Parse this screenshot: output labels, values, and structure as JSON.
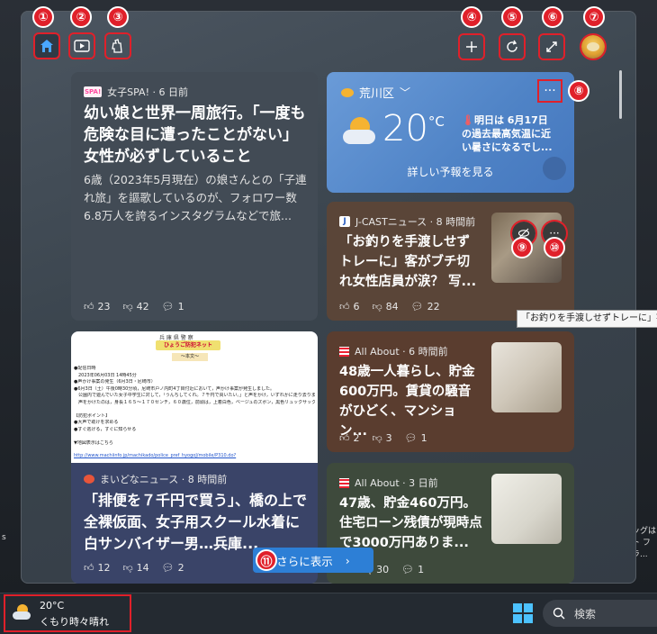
{
  "toolbar": {
    "home_icon": "home-icon",
    "video_icon": "video-icon",
    "games_icon": "games-icon",
    "add_icon": "add-icon",
    "refresh_icon": "refresh-icon",
    "expand_icon": "expand-icon",
    "profile_icon": "avatar"
  },
  "badges": {
    "b1": "①",
    "b2": "②",
    "b3": "③",
    "b4": "④",
    "b5": "⑤",
    "b6": "⑥",
    "b7": "⑦",
    "b8": "⑧",
    "b9": "⑨",
    "b10": "⑩",
    "b11": "⑪"
  },
  "weather": {
    "location": "荒川区",
    "temp": "20",
    "unit": "°C",
    "alert_line1": "明日は 6月17日",
    "alert_line2": "の過去最高気温に近",
    "alert_line3": "い暑さになるでし...",
    "forecast_link": "詳しい予報を見る",
    "more": "···"
  },
  "card1": {
    "source": "女子SPA! · 6 日前",
    "source_logo": "SPA!",
    "title": "幼い娘と世界一周旅行。「一度も危険な目に遭ったことがない」女性が必ずしていること",
    "desc": "6歳（2023年5月現在）の娘さんとの「子連れ旅」を謳歌しているのが、フォロワー数6.8万人を誇るインスタグラムなどで旅...",
    "likes": "23",
    "dislikes": "42",
    "comments": "1"
  },
  "card2": {
    "source": "J-CASTニュース · 8 時間前",
    "source_logo": "J",
    "title": "「お釣りを手渡しせずトレーに」客がブチ切れ女性店員が涙？ 写...",
    "likes": "6",
    "dislikes": "84",
    "comments": "22",
    "tooltip": "「お釣りを手渡しせずトレーに」客が"
  },
  "card3": {
    "source": "まいどなニュース · 8 時間前",
    "title": "「排便を７千円で買う」、橋の上で全裸仮面、女子用スクール水着に白サンバイザー男…兵庫...",
    "likes": "12",
    "dislikes": "14",
    "comments": "2",
    "image_header1": "兵 庫 県 警 察",
    "image_header2": "ひょうご防犯ネット",
    "image_header3": "～本文～",
    "image_lines": [
      "●配信日時",
      "　2023年06月03日 14時45分",
      "●声かけ事案の発生（6月3日・尼崎市）",
      "●6月3日（土）午後0時30分頃，尼崎市戸ノ内町4丁目付近において，声かけ事案が発生しました。",
      "　公園内で遊んでいた女子中学生に対して，「うんちしてくれ。７千円で買いたい。」と声をかけ，いずれかに走り去りました。",
      "　声をかけたのは，身長１６５～１７０センチ，６０歳位，前頭は，上着白色，ベージュのズボン，黒色リュックサック着用の男です。",
      "",
      "【防犯ポイント】",
      "●大声で助けを求める",
      "●すぐ逃げる，すぐに知らせる",
      "",
      "▼地図表示はこちら"
    ],
    "image_url": "http://www.machiinfo.jp/machikado/police_pref_hyogoJ/mobile/P310.do?"
  },
  "card4": {
    "source": "All About · 6 時間前",
    "title": "48歳一人暮らし、貯金600万円。賃貸の騒音がひどく、マンション...",
    "likes": "2",
    "dislikes": "3",
    "comments": "1"
  },
  "card5": {
    "source": "All About · 3 日前",
    "title": "47歳、貯金460万円。住宅ローン残債が現時点で3000万円ありま...",
    "dislikes": "30",
    "comments": "1"
  },
  "more_button": "さらに表示",
  "side_text": {
    "left": "s",
    "right1": "ッグは",
    "right2": "ト フラ..."
  },
  "taskbar": {
    "temp": "20°C",
    "condition": "くもり時々晴れ",
    "search_placeholder": "検索"
  }
}
